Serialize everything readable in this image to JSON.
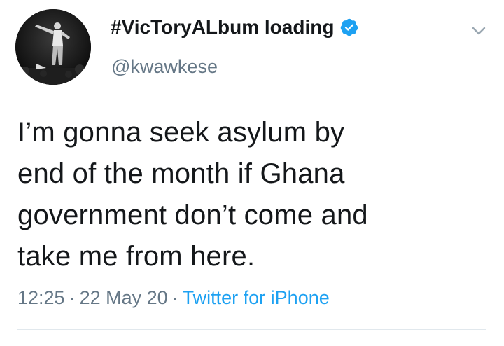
{
  "tweet": {
    "author": {
      "display_name": "#VicToryALbum loading",
      "handle": "@kwawkese",
      "verified": true,
      "avatar_icon": "profile-photo"
    },
    "text": "I’m gonna seek asylum by\nend of the month if Ghana\ngovernment don’t come and\ntake me from here.",
    "time": "12:25",
    "date": "22 May 20",
    "separator": "·",
    "source": "Twitter for iPhone",
    "menu_icon": "chevron-down-icon"
  },
  "colors": {
    "text": "#14171a",
    "secondary": "#657786",
    "link": "#1da1f2",
    "verified_badge": "#1da1f2",
    "divider": "#e1e8ed"
  }
}
